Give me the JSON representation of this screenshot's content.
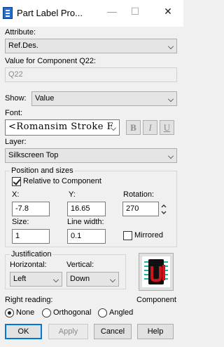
{
  "window": {
    "title": "Part Label Pro...",
    "controls": {
      "minimize": "—",
      "maximize": "☐",
      "close": "✕"
    }
  },
  "attribute": {
    "label": "Attribute:",
    "value": "Ref.Des."
  },
  "value_for_component": {
    "label": "Value for Component Q22:",
    "value": "Q22"
  },
  "show": {
    "label": "Show:",
    "value": "Value"
  },
  "font": {
    "label": "Font:",
    "value": "<Romansim Stroke F",
    "bold": "B",
    "italic": "I",
    "underline": "U"
  },
  "layer": {
    "label": "Layer:",
    "value": "Silkscreen Top"
  },
  "position": {
    "group_label": "Position and sizes",
    "relative_label": "Relative to Component",
    "relative_checked": true,
    "x_label": "X:",
    "x_value": "-7.8",
    "y_label": "Y:",
    "y_value": "16.65",
    "rotation_label": "Rotation:",
    "rotation_value": "270",
    "size_label": "Size:",
    "size_value": "1",
    "line_width_label": "Line width:",
    "line_width_value": "0.1",
    "mirrored_label": "Mirrored",
    "mirrored_checked": false
  },
  "justification": {
    "group_label": "Justification",
    "horizontal_label": "Horizontal:",
    "horizontal_value": "Left",
    "vertical_label": "Vertical:",
    "vertical_value": "Down"
  },
  "component": {
    "label": "Component"
  },
  "right_reading": {
    "label": "Right reading:",
    "options": [
      "None",
      "Orthogonal",
      "Angled"
    ],
    "selected": "None"
  },
  "buttons": {
    "ok": "OK",
    "apply": "Apply",
    "cancel": "Cancel",
    "help": "Help"
  },
  "colors": {
    "accent": "#0078d7",
    "icon_blue": "#1f6fd1",
    "component_red": "#d0141e",
    "component_teal": "#1bb3a4"
  }
}
